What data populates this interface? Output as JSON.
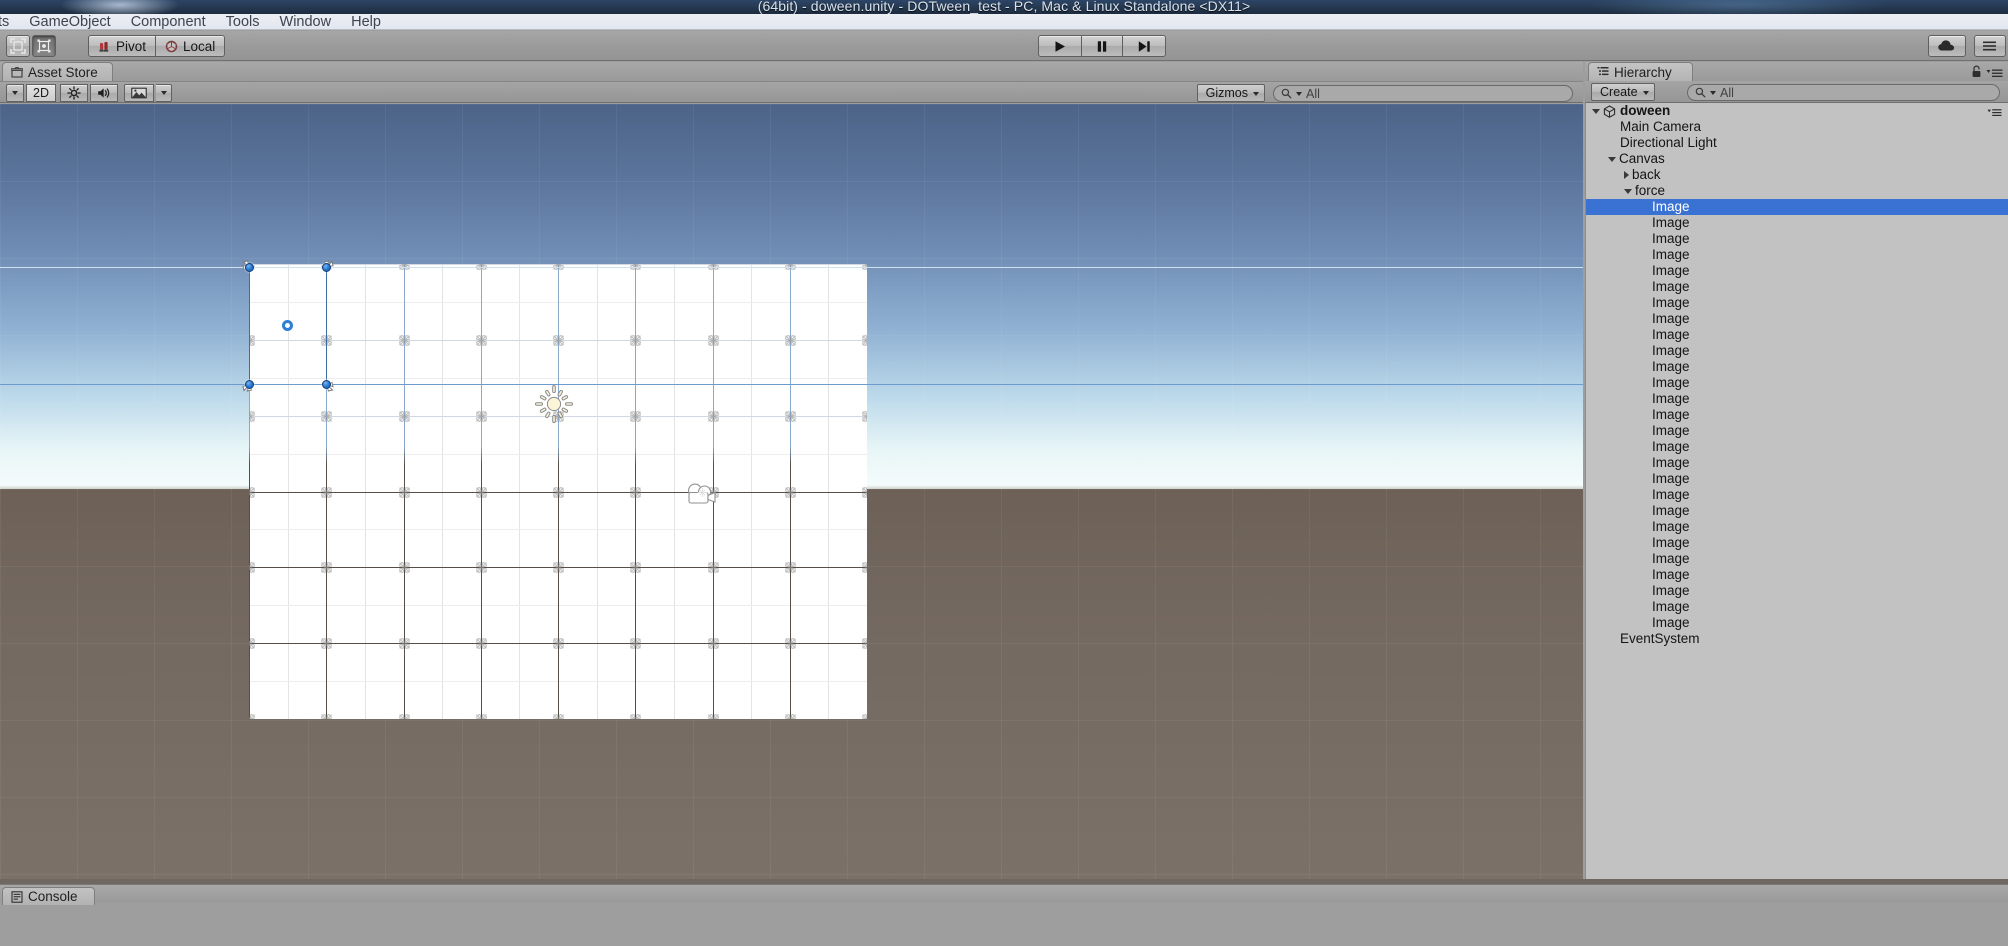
{
  "window": {
    "title": "(64bit) - doween.unity - DOTween_test - PC, Mac & Linux Standalone <DX11>",
    "cloud_icon": "cloud-icon"
  },
  "menubar": {
    "items": [
      {
        "label": "ts"
      },
      {
        "label": "GameObject"
      },
      {
        "label": "Component"
      },
      {
        "label": "Tools"
      },
      {
        "label": "Window"
      },
      {
        "label": "Help"
      }
    ]
  },
  "toolbar": {
    "tools": [
      {
        "name": "rect-tool",
        "icon": "rect-transform-icon",
        "active": false
      },
      {
        "name": "scale-tool",
        "icon": "scale-tool-icon",
        "active": true
      }
    ],
    "pivot_label": "Pivot",
    "pivot_icon": "pivot-icon",
    "space_label": "Local",
    "space_icon": "local-space-icon",
    "play_icon": "play-icon",
    "pause_icon": "pause-icon",
    "step_icon": "step-icon",
    "collab_icon": "cloud-icon",
    "account_icon": "account-icon"
  },
  "scene_panel": {
    "tab_label": "Asset Store",
    "tab_icon": "asset-store-icon",
    "toolbar": {
      "draw_mode_label": "",
      "draw_mode_arrow": "chevron-down-icon",
      "mode_2d_label": "2D",
      "lighting_icon": "lighting-icon",
      "audio_icon": "audio-icon",
      "effects_icon": "effects-icon",
      "effects_arrow": "chevron-down-icon",
      "gizmos_label": "Gizmos",
      "gizmos_arrow": "chevron-down-icon",
      "search_placeholder": "All",
      "search_value": "",
      "search_icon": "search-icon"
    },
    "scene_objects": [
      {
        "name": "directional-light-gizmo",
        "icon": "sun-icon"
      },
      {
        "name": "main-camera-gizmo",
        "icon": "camera-icon"
      }
    ],
    "selection": {
      "type": "rect-transform-gizmo",
      "handles": 4,
      "pivot": "pivot-ring"
    },
    "colors": {
      "sky_top": "#4d6488",
      "sky_horizon": "#e8f6f7",
      "ground": "#746961",
      "canvas_fill": "#ffffff",
      "grid_major": "#564f48",
      "grid_minor": "#e4e4e4",
      "gizmo_blue": "#2e7fd6",
      "selection_blue": "#3a72d4"
    }
  },
  "hierarchy": {
    "tab_label": "Hierarchy",
    "tab_icon": "hierarchy-icon",
    "lock_icon": "lock-icon",
    "menu_icon": "panel-menu-icon",
    "create_label": "Create",
    "create_arrow": "chevron-down-icon",
    "search_placeholder": "All",
    "search_value": "",
    "search_icon": "search-icon",
    "tree": [
      {
        "label": "doween",
        "depth": 0,
        "expander": "down",
        "icon": "unity-scene-icon",
        "selected": false,
        "bold": true
      },
      {
        "label": "Main Camera",
        "depth": 1,
        "expander": "none",
        "icon": "",
        "selected": false,
        "bold": false
      },
      {
        "label": "Directional Light",
        "depth": 1,
        "expander": "none",
        "icon": "",
        "selected": false,
        "bold": false
      },
      {
        "label": "Canvas",
        "depth": 1,
        "expander": "down",
        "icon": "",
        "selected": false,
        "bold": false
      },
      {
        "label": "back",
        "depth": 2,
        "expander": "right",
        "icon": "",
        "selected": false,
        "bold": false
      },
      {
        "label": "force",
        "depth": 2,
        "expander": "down",
        "icon": "",
        "selected": false,
        "bold": false
      },
      {
        "label": "Image",
        "depth": 3,
        "expander": "none",
        "icon": "",
        "selected": true,
        "bold": false
      },
      {
        "label": "Image",
        "depth": 3,
        "expander": "none",
        "icon": "",
        "selected": false,
        "bold": false
      },
      {
        "label": "Image",
        "depth": 3,
        "expander": "none",
        "icon": "",
        "selected": false,
        "bold": false
      },
      {
        "label": "Image",
        "depth": 3,
        "expander": "none",
        "icon": "",
        "selected": false,
        "bold": false
      },
      {
        "label": "Image",
        "depth": 3,
        "expander": "none",
        "icon": "",
        "selected": false,
        "bold": false
      },
      {
        "label": "Image",
        "depth": 3,
        "expander": "none",
        "icon": "",
        "selected": false,
        "bold": false
      },
      {
        "label": "Image",
        "depth": 3,
        "expander": "none",
        "icon": "",
        "selected": false,
        "bold": false
      },
      {
        "label": "Image",
        "depth": 3,
        "expander": "none",
        "icon": "",
        "selected": false,
        "bold": false
      },
      {
        "label": "Image",
        "depth": 3,
        "expander": "none",
        "icon": "",
        "selected": false,
        "bold": false
      },
      {
        "label": "Image",
        "depth": 3,
        "expander": "none",
        "icon": "",
        "selected": false,
        "bold": false
      },
      {
        "label": "Image",
        "depth": 3,
        "expander": "none",
        "icon": "",
        "selected": false,
        "bold": false
      },
      {
        "label": "Image",
        "depth": 3,
        "expander": "none",
        "icon": "",
        "selected": false,
        "bold": false
      },
      {
        "label": "Image",
        "depth": 3,
        "expander": "none",
        "icon": "",
        "selected": false,
        "bold": false
      },
      {
        "label": "Image",
        "depth": 3,
        "expander": "none",
        "icon": "",
        "selected": false,
        "bold": false
      },
      {
        "label": "Image",
        "depth": 3,
        "expander": "none",
        "icon": "",
        "selected": false,
        "bold": false
      },
      {
        "label": "Image",
        "depth": 3,
        "expander": "none",
        "icon": "",
        "selected": false,
        "bold": false
      },
      {
        "label": "Image",
        "depth": 3,
        "expander": "none",
        "icon": "",
        "selected": false,
        "bold": false
      },
      {
        "label": "Image",
        "depth": 3,
        "expander": "none",
        "icon": "",
        "selected": false,
        "bold": false
      },
      {
        "label": "Image",
        "depth": 3,
        "expander": "none",
        "icon": "",
        "selected": false,
        "bold": false
      },
      {
        "label": "Image",
        "depth": 3,
        "expander": "none",
        "icon": "",
        "selected": false,
        "bold": false
      },
      {
        "label": "Image",
        "depth": 3,
        "expander": "none",
        "icon": "",
        "selected": false,
        "bold": false
      },
      {
        "label": "Image",
        "depth": 3,
        "expander": "none",
        "icon": "",
        "selected": false,
        "bold": false
      },
      {
        "label": "Image",
        "depth": 3,
        "expander": "none",
        "icon": "",
        "selected": false,
        "bold": false
      },
      {
        "label": "Image",
        "depth": 3,
        "expander": "none",
        "icon": "",
        "selected": false,
        "bold": false
      },
      {
        "label": "Image",
        "depth": 3,
        "expander": "none",
        "icon": "",
        "selected": false,
        "bold": false
      },
      {
        "label": "Image",
        "depth": 3,
        "expander": "none",
        "icon": "",
        "selected": false,
        "bold": false
      },
      {
        "label": "Image",
        "depth": 3,
        "expander": "none",
        "icon": "",
        "selected": false,
        "bold": false
      },
      {
        "label": "EventSystem",
        "depth": 1,
        "expander": "none",
        "icon": "",
        "selected": false,
        "bold": false
      }
    ]
  },
  "console": {
    "tab_label": "Console",
    "tab_icon": "console-icon"
  }
}
